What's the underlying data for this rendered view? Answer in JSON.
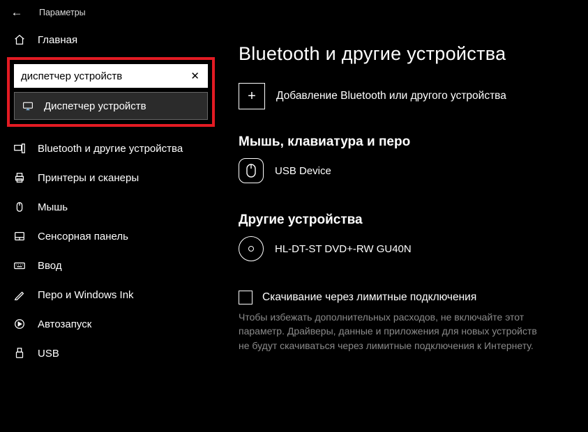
{
  "titlebar": {
    "title": "Параметры"
  },
  "sidebar": {
    "home": "Главная",
    "search_value": "диспетчер устройств",
    "suggestion": "Диспетчер устройств",
    "items": [
      "Bluetooth и другие устройства",
      "Принтеры и сканеры",
      "Мышь",
      "Сенсорная панель",
      "Ввод",
      "Перо и Windows Ink",
      "Автозапуск",
      "USB"
    ]
  },
  "main": {
    "title": "Bluetooth и другие устройства",
    "add_label": "Добавление Bluetooth или другого устройства",
    "sec1_title": "Мышь, клавиатура и перо",
    "sec1_dev": "USB Device",
    "sec2_title": "Другие устройства",
    "sec2_dev": "HL-DT-ST DVD+-RW GU40N",
    "check_label": "Скачивание через лимитные подключения",
    "desc": "Чтобы избежать дополнительных расходов, не включайте этот параметр. Драйверы, данные и приложения для новых устройств не будут скачиваться через лимитные подключения к Интернету."
  }
}
